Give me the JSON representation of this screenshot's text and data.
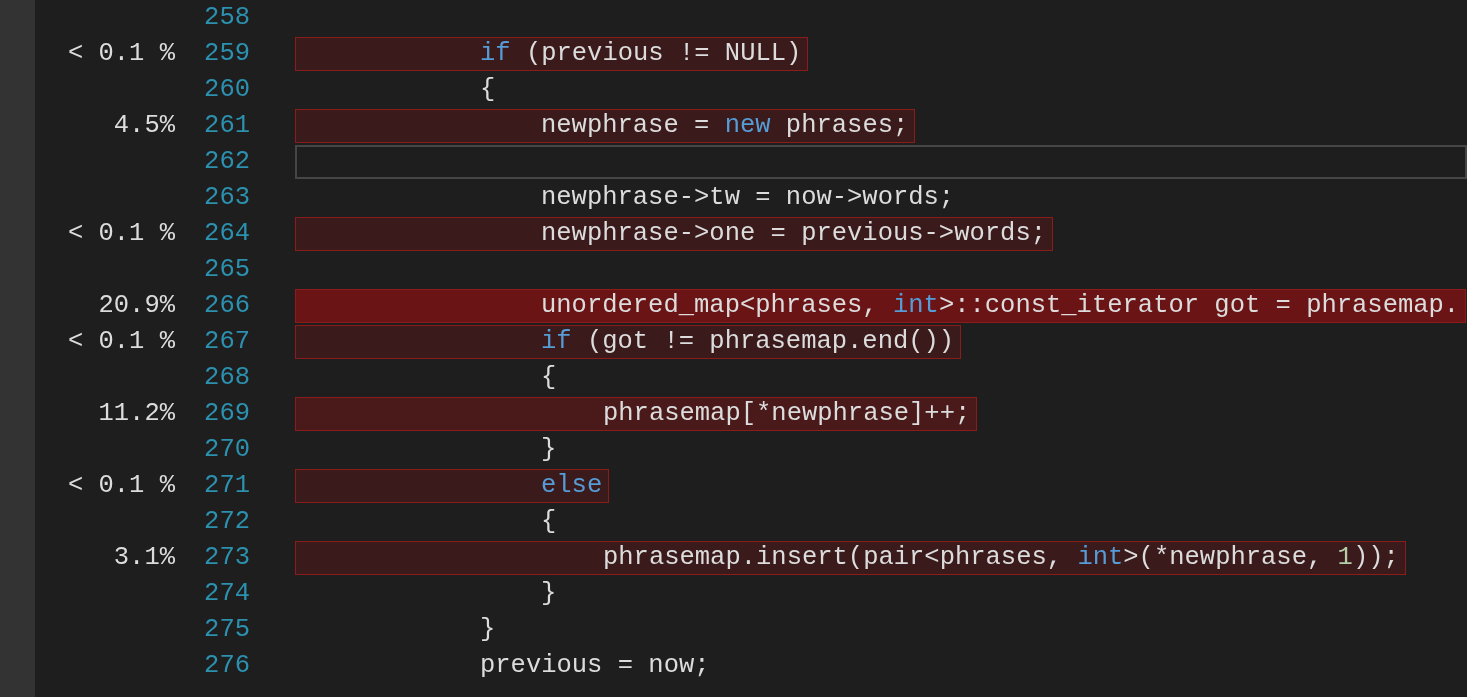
{
  "lines": [
    {
      "number": "258",
      "hot": false,
      "current": false
    },
    {
      "number": "259",
      "percent": "< 0.1 %",
      "hot": true,
      "color": "#3a1a1b",
      "current": false,
      "kind": "outer",
      "tokens": [
        {
          "text": "if",
          "kind": "keyword"
        },
        {
          "text": " (previous != NULL)",
          "kind": "plain"
        }
      ]
    },
    {
      "number": "260",
      "hot": false,
      "current": false,
      "kind": "outer",
      "tokens": [
        {
          "text": "{",
          "kind": "plain"
        }
      ]
    },
    {
      "number": "261",
      "percent": "4.5%",
      "hot": true,
      "color": "#3a1a1b",
      "current": false,
      "kind": "middle",
      "tokens": [
        {
          "text": "newphrase = ",
          "kind": "plain"
        },
        {
          "text": "new",
          "kind": "keyword"
        },
        {
          "text": " phrases;",
          "kind": "plain"
        }
      ]
    },
    {
      "number": "262",
      "hot": false,
      "current": true
    },
    {
      "number": "263",
      "hot": false,
      "current": false,
      "kind": "middle",
      "tokens": [
        {
          "text": "newphrase->tw = now->words;",
          "kind": "plain"
        }
      ]
    },
    {
      "number": "264",
      "percent": "< 0.1 %",
      "hot": true,
      "color": "#3a1a1b",
      "current": false,
      "kind": "middle",
      "tokens": [
        {
          "text": "newphrase->one = previous->words;",
          "kind": "plain"
        }
      ]
    },
    {
      "number": "265",
      "hot": false,
      "current": false
    },
    {
      "number": "266",
      "percent": "20.9%",
      "hot": true,
      "color": "#6a1416",
      "current": false,
      "kind": "middle",
      "tokens": [
        {
          "text": "unordered_map<phrases, ",
          "kind": "plain"
        },
        {
          "text": "int",
          "kind": "keyword"
        },
        {
          "text": ">::const_iterator got = phrasemap.",
          "kind": "plain"
        }
      ]
    },
    {
      "number": "267",
      "percent": "< 0.1 %",
      "hot": true,
      "color": "#3a1a1b",
      "current": false,
      "kind": "middle",
      "tokens": [
        {
          "text": "if",
          "kind": "keyword"
        },
        {
          "text": " (got != phrasemap.end())",
          "kind": "plain"
        }
      ]
    },
    {
      "number": "268",
      "hot": false,
      "current": false,
      "kind": "middle",
      "tokens": [
        {
          "text": "{",
          "kind": "plain"
        }
      ]
    },
    {
      "number": "269",
      "percent": "11.2%",
      "hot": true,
      "color": "#4a1a1b",
      "current": false,
      "kind": "inner",
      "tokens": [
        {
          "text": "phrasemap[*newphrase]++;",
          "kind": "plain"
        }
      ]
    },
    {
      "number": "270",
      "hot": false,
      "current": false,
      "kind": "middle",
      "tokens": [
        {
          "text": "}",
          "kind": "plain"
        }
      ]
    },
    {
      "number": "271",
      "percent": "< 0.1 %",
      "hot": true,
      "color": "#3a1a1b",
      "current": false,
      "kind": "middle",
      "tokens": [
        {
          "text": "else",
          "kind": "keyword"
        }
      ]
    },
    {
      "number": "272",
      "hot": false,
      "current": false,
      "kind": "middle",
      "tokens": [
        {
          "text": "{",
          "kind": "plain"
        }
      ]
    },
    {
      "number": "273",
      "percent": "3.1%",
      "hot": true,
      "color": "#3a1a1b",
      "current": false,
      "kind": "inner",
      "tokens": [
        {
          "text": "phrasemap.insert(pair<phrases, ",
          "kind": "plain"
        },
        {
          "text": "int",
          "kind": "keyword"
        },
        {
          "text": ">(*newphrase, ",
          "kind": "plain"
        },
        {
          "text": "1",
          "kind": "number"
        },
        {
          "text": "));",
          "kind": "plain"
        }
      ]
    },
    {
      "number": "274",
      "hot": false,
      "current": false,
      "kind": "middle",
      "tokens": [
        {
          "text": "}",
          "kind": "plain"
        }
      ]
    },
    {
      "number": "275",
      "hot": false,
      "current": false,
      "kind": "outer",
      "tokens": [
        {
          "text": "}",
          "kind": "plain"
        }
      ]
    },
    {
      "number": "276",
      "hot": false,
      "current": false,
      "kind": "outer",
      "tokens": [
        {
          "text": "previous = now;",
          "kind": "plain"
        }
      ]
    }
  ]
}
